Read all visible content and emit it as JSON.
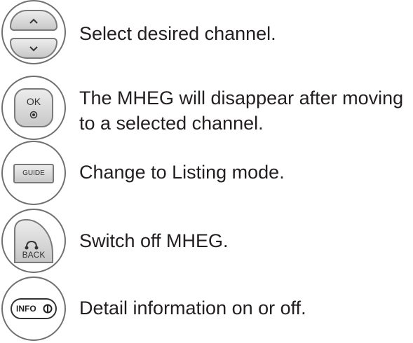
{
  "rows": [
    {
      "text": "Select desired channel.",
      "icon": "up-down-arrow-buttons"
    },
    {
      "text": "The MHEG will disappear after moving",
      "text_line2": "to a selected channel.",
      "icon": "ok-button",
      "button_label": "OK"
    },
    {
      "text": "Change to Listing mode.",
      "icon": "guide-button",
      "button_label": "GUIDE"
    },
    {
      "text": "Switch off MHEG.",
      "icon": "back-button",
      "button_label": "BACK"
    },
    {
      "text": "Detail information on or off.",
      "icon": "info-button",
      "button_label": "INFO"
    }
  ]
}
